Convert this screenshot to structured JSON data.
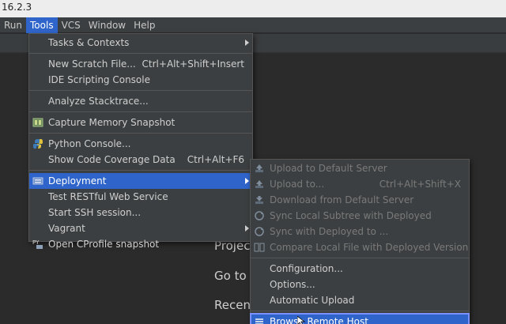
{
  "window": {
    "title": "16.2.3"
  },
  "menubar": {
    "items": [
      {
        "label": "Run",
        "active": false
      },
      {
        "label": "Tools",
        "active": true
      },
      {
        "label": "VCS",
        "active": false
      },
      {
        "label": "Window",
        "active": false
      },
      {
        "label": "Help",
        "active": false
      }
    ]
  },
  "welcome": {
    "project_text": "Projec",
    "goto_text": "Go to",
    "recent_text": "Recen"
  },
  "tools_menu": {
    "items": [
      {
        "label": "Tasks & Contexts",
        "shortcut": "",
        "submenu": true,
        "icon": ""
      },
      {
        "label": "New Scratch File...",
        "shortcut": "Ctrl+Alt+Shift+Insert",
        "submenu": false,
        "icon": ""
      },
      {
        "label": "IDE Scripting Console",
        "shortcut": "",
        "submenu": false,
        "icon": ""
      },
      {
        "label": "Analyze Stacktrace...",
        "shortcut": "",
        "submenu": false,
        "icon": ""
      },
      {
        "label": "Capture Memory Snapshot",
        "shortcut": "",
        "submenu": false,
        "icon": "memory-snapshot-icon"
      },
      {
        "label": "Python Console...",
        "shortcut": "",
        "submenu": false,
        "icon": "python-icon"
      },
      {
        "label": "Show Code Coverage Data",
        "shortcut": "Ctrl+Alt+F6",
        "submenu": false,
        "icon": ""
      },
      {
        "label": "Deployment",
        "shortcut": "",
        "submenu": true,
        "icon": "deployment-icon",
        "selected": true
      },
      {
        "label": "Test RESTful Web Service",
        "shortcut": "",
        "submenu": false,
        "icon": ""
      },
      {
        "label": "Start SSH session...",
        "shortcut": "",
        "submenu": false,
        "icon": ""
      },
      {
        "label": "Vagrant",
        "shortcut": "",
        "submenu": true,
        "icon": ""
      },
      {
        "label": "Open CProfile snapshot",
        "shortcut": "",
        "submenu": false,
        "icon": "cprofile-icon"
      }
    ]
  },
  "deployment_menu": {
    "items": [
      {
        "label": "Upload to Default Server",
        "shortcut": "",
        "disabled": true,
        "icon": "upload-icon"
      },
      {
        "label": "Upload to...",
        "shortcut": "Ctrl+Alt+Shift+X",
        "disabled": true,
        "icon": "upload-icon"
      },
      {
        "label": "Download from Default Server",
        "shortcut": "",
        "disabled": true,
        "icon": "download-icon"
      },
      {
        "label": "Sync Local Subtree with Deployed",
        "shortcut": "",
        "disabled": true,
        "icon": "sync-icon"
      },
      {
        "label": "Sync with Deployed to ...",
        "shortcut": "",
        "disabled": true,
        "icon": "sync-icon"
      },
      {
        "label": "Compare Local File with Deployed Version",
        "shortcut": "",
        "disabled": true,
        "icon": "compare-icon"
      },
      {
        "label": "Configuration...",
        "shortcut": "",
        "disabled": false,
        "icon": ""
      },
      {
        "label": "Options...",
        "shortcut": "",
        "disabled": false,
        "icon": ""
      },
      {
        "label": "Automatic Upload",
        "shortcut": "",
        "disabled": false,
        "icon": ""
      },
      {
        "label": "Browse Remote Host",
        "shortcut": "",
        "disabled": false,
        "icon": "remote-host-icon",
        "hovered": true
      }
    ]
  },
  "colors": {
    "accent": "#2f65ca",
    "menu_bg": "#3c3f41",
    "editor_bg": "#2b2b2b",
    "disabled_text": "#7a7a7a"
  }
}
